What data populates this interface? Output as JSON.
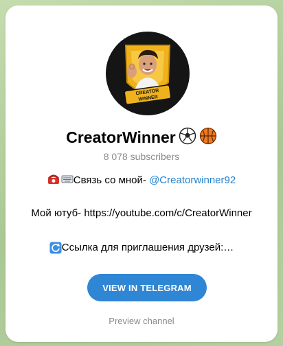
{
  "channel": {
    "title": "CreatorWinner",
    "title_emojis": [
      "soccer-ball-icon",
      "basketball-icon"
    ],
    "subscribers": "8 078 subscribers",
    "avatar_badge_text": "CREATOR WINNER"
  },
  "description": {
    "line1_text": "Связь со мной- ",
    "line1_icons": [
      "telephone-icon",
      "keyboard-icon"
    ],
    "line1_mention": "@Creatorwinner92",
    "line2": "Мой ютуб- https://youtube.com/c/CreatorWinner",
    "line3_icon": "arrows-counterclockwise-icon",
    "line3_text": "Ссылка для приглашения друзей:…"
  },
  "actions": {
    "view_button": "VIEW IN TELEGRAM",
    "preview_link": "Preview channel"
  },
  "colors": {
    "accent": "#2f86d4",
    "mention": "#2481cc",
    "secondary_text": "#8a8a8a",
    "background": "#b9d3a3"
  }
}
